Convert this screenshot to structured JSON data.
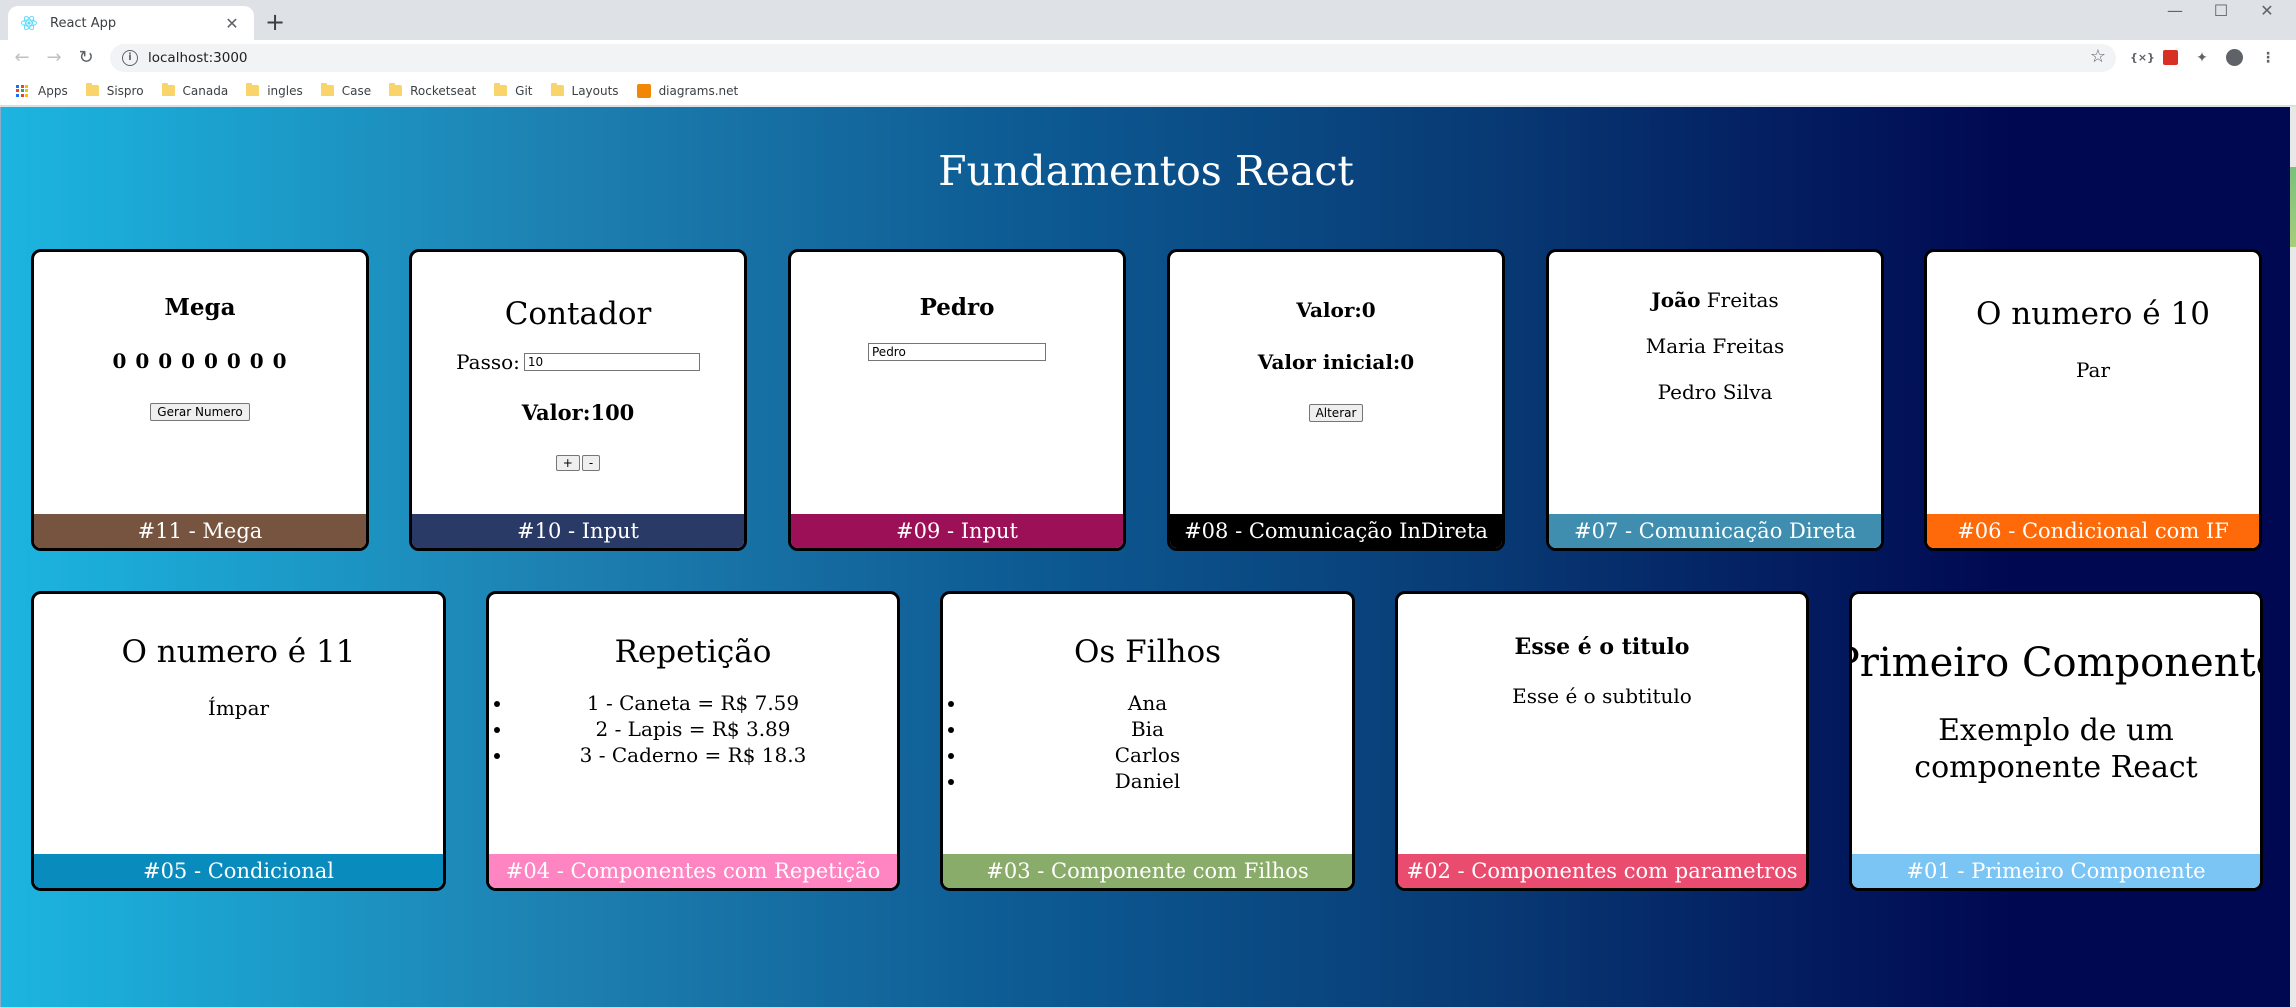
{
  "browser": {
    "tab_title": "React App",
    "tab_close": "✕",
    "new_tab": "+",
    "url": "localhost:3000",
    "window_controls": [
      "—",
      "☐",
      "✕"
    ],
    "bookmarks": [
      {
        "label": "Apps",
        "icon": "apps-grid-icon"
      },
      {
        "label": "Sispro",
        "icon": "folder-icon"
      },
      {
        "label": "Canada",
        "icon": "folder-icon"
      },
      {
        "label": "ingles",
        "icon": "folder-icon"
      },
      {
        "label": "Case",
        "icon": "folder-icon"
      },
      {
        "label": "Rocketseat",
        "icon": "folder-icon"
      },
      {
        "label": "Git",
        "icon": "folder-icon"
      },
      {
        "label": "Layouts",
        "icon": "folder-icon"
      },
      {
        "label": "diagrams.net",
        "icon": "drawio-icon"
      }
    ]
  },
  "page": {
    "title": "Fundamentos React"
  },
  "cards": {
    "c11": {
      "footer": "#11 - Mega",
      "color": "#77543f",
      "title": "Mega",
      "numbers": "0 0 0 0 0 0 0 0",
      "button": "Gerar Numero"
    },
    "c10": {
      "footer": "#10 - Input",
      "color": "#2a3a66",
      "title": "Contador",
      "step_label": "Passo:",
      "step_value": "10",
      "value": "Valor:100",
      "inc": "+",
      "dec": "-"
    },
    "c09": {
      "footer": "#09 - Input",
      "color": "#9c1057",
      "title": "Pedro",
      "input_value": "Pedro"
    },
    "c08": {
      "footer": "#08 - Comunicação InDireta",
      "color": "#000000",
      "value": "Valor:0",
      "initial": "Valor inicial:0",
      "button": "Alterar"
    },
    "c07": {
      "footer": "#07 - Comunicação Direta",
      "color": "#3f8eaf",
      "line1_first": "João",
      "line1_last": " Freitas",
      "line2": "Maria Freitas",
      "line3": "Pedro Silva"
    },
    "c06": {
      "footer": "#06 - Condicional com IF",
      "color": "#fe6a0a",
      "title": "O numero é 10",
      "result": "Par"
    },
    "c05": {
      "footer": "#05 - Condicional",
      "color": "#0a8bbd",
      "title": "O numero é 11",
      "result": "Ímpar"
    },
    "c04": {
      "footer": "#04 - Componentes com Repetição",
      "color": "#fe85c1",
      "title": "Repetição",
      "items": [
        "1 - Caneta = R$ 7.59",
        "2 - Lapis = R$ 3.89",
        "3 - Caderno = R$ 18.3"
      ]
    },
    "c03": {
      "footer": "#03 - Componente com Filhos",
      "color": "#8aac6a",
      "title": "Os Filhos",
      "items": [
        "Ana",
        "Bia",
        "Carlos",
        "Daniel"
      ]
    },
    "c02": {
      "footer": "#02 - Componentes com parametros",
      "color": "#e94c6f",
      "title": "Esse é o titulo",
      "subtitle": "Esse é o subtitulo"
    },
    "c01": {
      "footer": "#01 - Primeiro Componente",
      "color": "#7bc5f5",
      "title": "Primeiro Componente",
      "subtitle": "Exemplo de um componente React"
    }
  }
}
